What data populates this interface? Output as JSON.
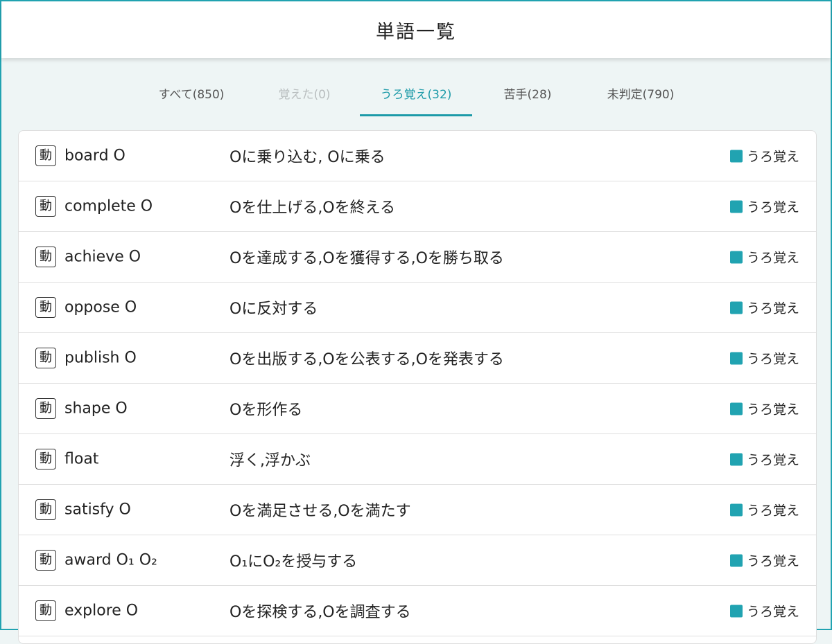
{
  "header": {
    "title": "単語一覧"
  },
  "colors": {
    "accent": "#1c9aa8",
    "status": "#21a3b1",
    "disabled": "#b8bdbe"
  },
  "tabs": [
    {
      "label": "すべて(850)",
      "state": "normal"
    },
    {
      "label": "覚えた(0)",
      "state": "disabled"
    },
    {
      "label": "うろ覚え(32)",
      "state": "active"
    },
    {
      "label": "苦手(28)",
      "state": "normal"
    },
    {
      "label": "未判定(790)",
      "state": "normal"
    }
  ],
  "words": [
    {
      "pos": "動",
      "word": "board O",
      "meaning": "Oに乗り込む, Oに乗る",
      "status": "うろ覚え"
    },
    {
      "pos": "動",
      "word": "complete O",
      "meaning": "Oを仕上げる,Oを終える",
      "status": "うろ覚え"
    },
    {
      "pos": "動",
      "word": "achieve O",
      "meaning": "Oを達成する,Oを獲得する,Oを勝ち取る",
      "status": "うろ覚え"
    },
    {
      "pos": "動",
      "word": "oppose O",
      "meaning": "Oに反対する",
      "status": "うろ覚え"
    },
    {
      "pos": "動",
      "word": "publish O",
      "meaning": "Oを出版する,Oを公表する,Oを発表する",
      "status": "うろ覚え"
    },
    {
      "pos": "動",
      "word": "shape O",
      "meaning": "Oを形作る",
      "status": "うろ覚え"
    },
    {
      "pos": "動",
      "word": "float",
      "meaning": "浮く,浮かぶ",
      "status": "うろ覚え"
    },
    {
      "pos": "動",
      "word": "satisfy O",
      "meaning": "Oを満足させる,Oを満たす",
      "status": "うろ覚え"
    },
    {
      "pos": "動",
      "word": "award O₁ O₂",
      "meaning": "O₁にO₂を授与する",
      "status": "うろ覚え"
    },
    {
      "pos": "動",
      "word": "explore O",
      "meaning": "Oを探検する,Oを調査する",
      "status": "うろ覚え"
    }
  ]
}
